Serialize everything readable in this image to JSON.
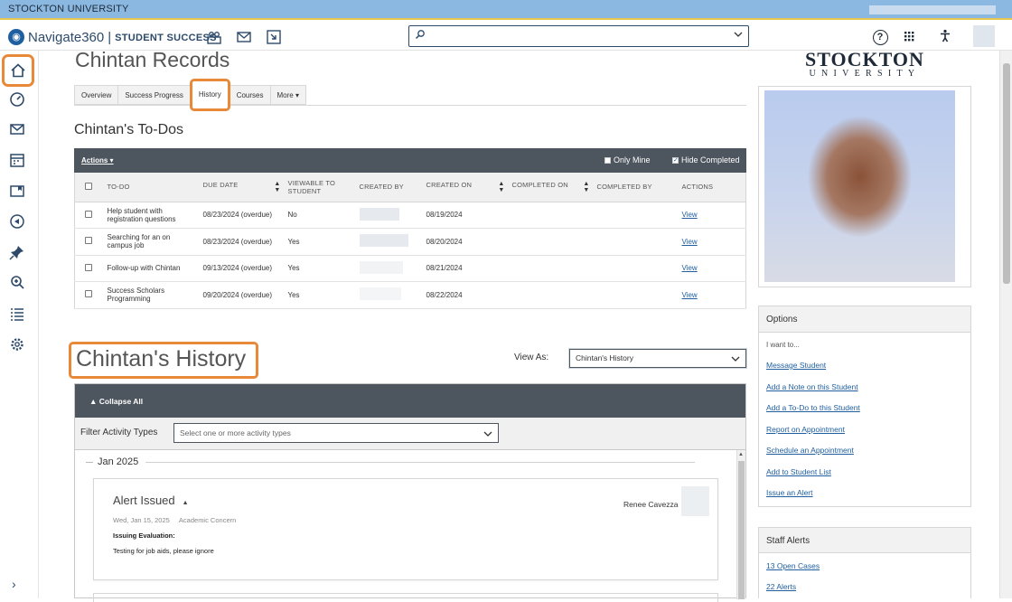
{
  "topbar": {
    "university": "STOCKTON UNIVERSITY"
  },
  "header": {
    "brand_name": "Navigate360",
    "brand_separator": "|",
    "brand_product": "STUDENT SUCCESS",
    "help_glyph": "?"
  },
  "student": {
    "records_title": "Chintan Records",
    "tabs": [
      {
        "label": "Overview"
      },
      {
        "label": "Success Progress"
      },
      {
        "label": "History",
        "active": true
      },
      {
        "label": "Courses"
      },
      {
        "label": "More ▾"
      }
    ]
  },
  "todos": {
    "title": "Chintan's To-Dos",
    "actions_label": "Actions ▾",
    "only_mine_label": "Only Mine",
    "hide_completed_label": "Hide Completed",
    "columns": [
      "TO-DO",
      "DUE DATE",
      "VIEWABLE TO STUDENT",
      "CREATED BY",
      "CREATED ON",
      "COMPLETED ON",
      "COMPLETED BY",
      "ACTIONS"
    ],
    "rows": [
      {
        "todo": "Help student with registration questions",
        "due": "08/23/2024 (overdue)",
        "viewable": "No",
        "created_on": "08/19/2024",
        "action": "View"
      },
      {
        "todo": "Searching for an on campus job",
        "due": "08/23/2024 (overdue)",
        "viewable": "Yes",
        "created_on": "08/20/2024",
        "action": "View"
      },
      {
        "todo": "Follow-up with Chintan",
        "due": "09/13/2024 (overdue)",
        "viewable": "Yes",
        "created_on": "08/21/2024",
        "action": "View"
      },
      {
        "todo": "Success Scholars Programming",
        "due": "09/20/2024 (overdue)",
        "viewable": "Yes",
        "created_on": "08/22/2024",
        "action": "View"
      }
    ]
  },
  "history": {
    "title": "Chintan's History",
    "view_as_label": "View As:",
    "view_as_value": "Chintan's History",
    "collapse_label": "Collapse All",
    "filter_label": "Filter Activity Types",
    "filter_placeholder": "Select one or more activity types",
    "month": "Jan 2025",
    "card": {
      "title": "Alert Issued",
      "date": "Wed, Jan 15, 2025",
      "category": "Academic Concern",
      "author": "Renee Cavezza",
      "field_label": "Issuing Evaluation:",
      "body": "Testing for job aids, please ignore"
    }
  },
  "right": {
    "logo_big": "STOCKTON",
    "logo_small": "UNIVERSITY",
    "options_title": "Options",
    "options_intro": "I want to...",
    "options": [
      "Message Student",
      "Add a Note on this Student",
      "Add a To-Do to this Student",
      "Report on Appointment",
      "Schedule an Appointment",
      "Add to Student List",
      "Issue an Alert"
    ],
    "staff_alerts_title": "Staff Alerts",
    "staff_alerts": [
      "13 Open Cases",
      "22 Alerts"
    ]
  },
  "colors": {
    "accent_highlight": "#e8893a",
    "link": "#1f5fa0",
    "dark_bar": "#4d555e",
    "topbar": "#8bb8e0"
  },
  "icons": [
    "home-icon",
    "gauge-icon",
    "mail-icon",
    "calendar-icon",
    "folder-icon",
    "bullhorn-icon",
    "pin-icon",
    "magnify-icon",
    "list-icon",
    "gear-icon",
    "search-icon",
    "apps-grid-icon",
    "accessibility-icon"
  ]
}
